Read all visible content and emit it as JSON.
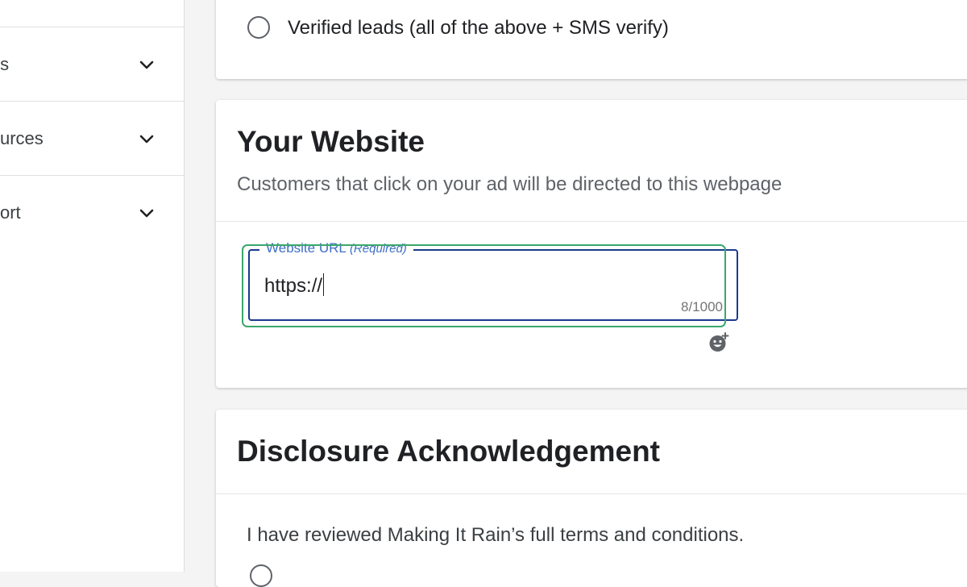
{
  "sidebar": {
    "items": [
      {
        "label": "ts",
        "icon": "chevron-down-icon"
      },
      {
        "label": "urces",
        "icon": "chevron-down-icon"
      },
      {
        "label": "ort",
        "icon": "chevron-down-icon"
      }
    ]
  },
  "lead_options": {
    "verified_label": "Verified leads (all of the above + SMS verify)"
  },
  "website_section": {
    "title": "Your Website",
    "subtitle": "Customers that click on your ad will be directed to this webpage",
    "url_field": {
      "label": "Website URL",
      "required_text": "(Required)",
      "value": "https://",
      "counter": "8/1000"
    },
    "emoji_icon": "add-emoji-icon"
  },
  "disclosure_section": {
    "title": "Disclosure Acknowledgement",
    "text": "I have reviewed Making It Rain’s full terms and conditions."
  },
  "colors": {
    "field_border": "#1a3a8f",
    "field_label": "#3f6fc4",
    "highlight": "#3aa76d"
  }
}
